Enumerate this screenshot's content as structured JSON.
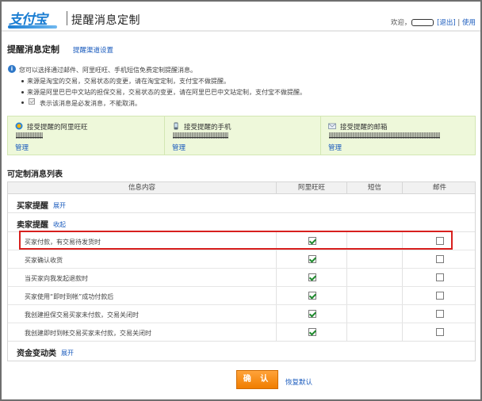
{
  "header": {
    "logo": "支付宝",
    "title": "提醒消息定制",
    "greeting": "欢迎，",
    "logout": "[退出]",
    "help": "使用"
  },
  "page": {
    "title": "提醒消息定制",
    "channel_settings_link": "提醒渠道设置"
  },
  "notes": {
    "intro": "您可以选择通过邮件、阿里旺旺、手机短信免费定制提醒消息。",
    "lines": [
      "来源是淘宝的交易，交易状态的变更，请在淘宝定制，支付宝不做提醒。",
      "来源是阿里巴巴中文站的担保交易，交易状态的变更，请在阿里巴巴中文站定制，支付宝不做提醒。",
      "表示该消息是必发消息，不能取消。"
    ]
  },
  "channels": [
    {
      "icon": "aliwangwang-icon",
      "title": "接受提醒的阿里旺旺",
      "manage": "管理"
    },
    {
      "icon": "mobile-phone-icon",
      "title": "接受提醒的手机",
      "manage": "管理"
    },
    {
      "icon": "mail-icon",
      "title": "接受提醒的邮箱",
      "manage": "管理"
    }
  ],
  "list": {
    "title": "可定制消息列表",
    "columns": [
      "信息内容",
      "阿里旺旺",
      "短信",
      "邮件"
    ],
    "groups": {
      "buyer": {
        "label": "买家提醒",
        "link": "展开"
      },
      "seller": {
        "label": "卖家提醒",
        "link": "收起"
      },
      "funds": {
        "label": "资金变动类",
        "link": "展开"
      }
    },
    "rows": [
      {
        "label": "买家付款，有交易待发货时",
        "wangwang": true,
        "sms": null,
        "email": false
      },
      {
        "label": "买家确认收货",
        "wangwang": true,
        "sms": null,
        "email": false
      },
      {
        "label": "当买家向我发起退款时",
        "wangwang": true,
        "sms": null,
        "email": false
      },
      {
        "label": "买家使用“即时到帐”成功付款后",
        "wangwang": true,
        "sms": null,
        "email": false
      },
      {
        "label": "我创建担保交易买家未付款，交易关闭时",
        "wangwang": true,
        "sms": null,
        "email": false
      },
      {
        "label": "我创建即时到帐交易买家未付款，交易关闭时",
        "wangwang": true,
        "sms": null,
        "email": false
      }
    ]
  },
  "actions": {
    "confirm": "确 认",
    "reset": "恢复默认"
  },
  "colors": {
    "link": "#1a5bbd",
    "brand": "#1a7dd2",
    "confirm_button": "#f07d00",
    "highlight_box": "#d8201e",
    "channel_panel": "#eef8da"
  }
}
